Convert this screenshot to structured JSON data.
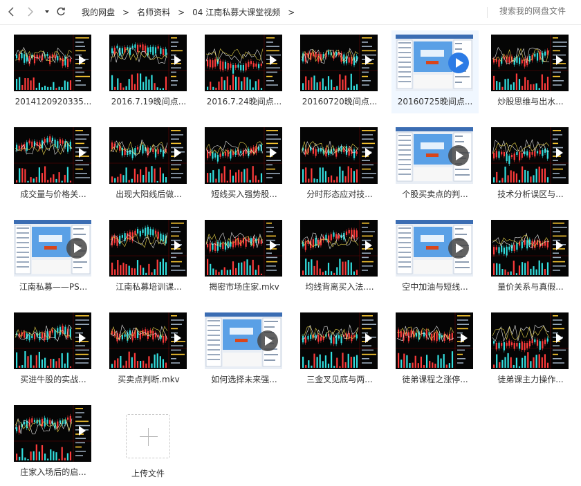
{
  "toolbar": {
    "back_icon": "chevron-left-icon",
    "forward_icon": "chevron-right-icon",
    "history_icon": "caret-down-icon",
    "refresh_icon": "refresh-icon",
    "breadcrumb": [
      "我的网盘",
      "名师资料",
      "04 江南私募大课堂视频"
    ],
    "separator": ">",
    "search_placeholder": "搜索我的网盘文件"
  },
  "files": [
    {
      "name": "2014120920335...",
      "style": "chart"
    },
    {
      "name": "2016.7.19晚间点...",
      "style": "chart"
    },
    {
      "name": "2016.7.24晚间点...",
      "style": "chart"
    },
    {
      "name": "20160720晚间点...",
      "style": "chart"
    },
    {
      "name": "20160725晚间点...",
      "style": "web",
      "selected": true
    },
    {
      "name": "炒股思维与出水...",
      "style": "chart"
    },
    {
      "name": "成交量与价格关...",
      "style": "chart"
    },
    {
      "name": "出现大阳线后做...",
      "style": "chart"
    },
    {
      "name": "短线买入强势股...",
      "style": "chart"
    },
    {
      "name": "分时形态应对技...",
      "style": "chart"
    },
    {
      "name": "个股买卖点的判...",
      "style": "web"
    },
    {
      "name": "技术分析误区与...",
      "style": "chart"
    },
    {
      "name": "江南私募——PS...",
      "style": "web"
    },
    {
      "name": "江南私募培训课...",
      "style": "chart"
    },
    {
      "name": "揭密市场庄家.mkv",
      "style": "chart"
    },
    {
      "name": "均线背离买入法....",
      "style": "chart"
    },
    {
      "name": "空中加油与短线...",
      "style": "web"
    },
    {
      "name": "量价关系与真假...",
      "style": "chart"
    },
    {
      "name": "买进牛股的实战...",
      "style": "chart"
    },
    {
      "name": "买卖点判断.mkv",
      "style": "chart"
    },
    {
      "name": "如何选择未来强...",
      "style": "web"
    },
    {
      "name": "三金叉见底与两...",
      "style": "chart"
    },
    {
      "name": "徒弟课程之涨停...",
      "style": "chart"
    },
    {
      "name": "徒弟课主力操作...",
      "style": "chart"
    },
    {
      "name": "庄家入场后的启...",
      "style": "chart"
    }
  ],
  "upload": {
    "label": "上传文件",
    "icon": "plus-icon"
  }
}
